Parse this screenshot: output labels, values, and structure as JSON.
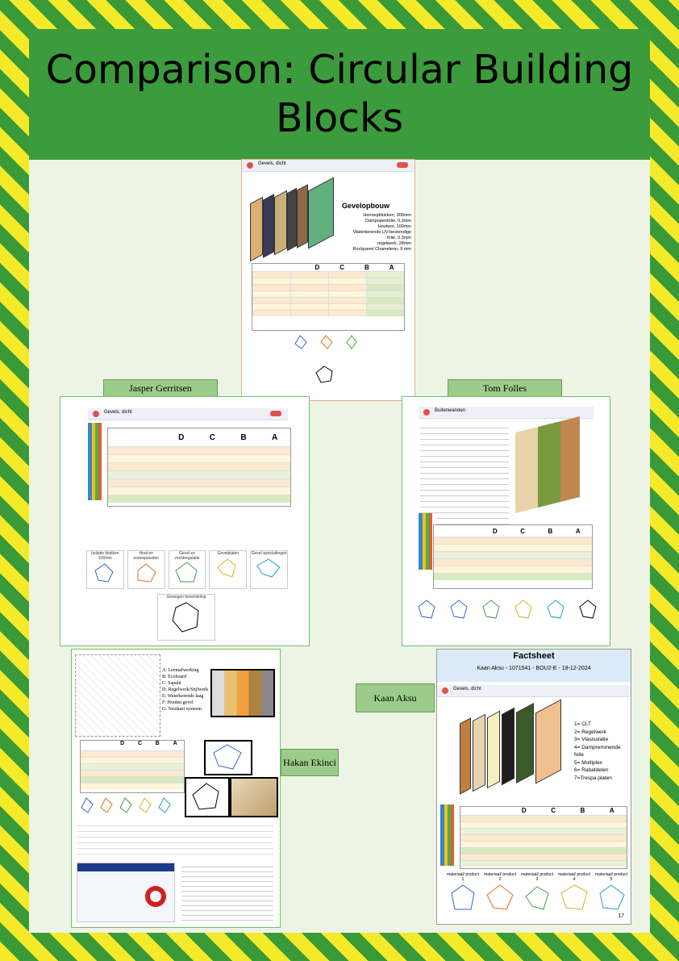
{
  "header": {
    "title": "Comparison: Circular Building Blocks"
  },
  "names": {
    "jasper": "Jasper Gerritsen",
    "tom": "Tom Folles",
    "hakan": "Hakan Ekinci",
    "kaan": "Kaan Aksu"
  },
  "top": {
    "toolbar_title": "Gevels, dicht",
    "heading": "Gevelopbouw",
    "layers": "Hennepblokken, 300mm\nDampopenfolie, 0,3mm\nHoutwol, 100mm\nWaterkerende UV-bestendige\nfolie, 0,3mm\nregelwerk, 28mm\nRockpanel Chameleon, 9 mm",
    "grades": [
      "D",
      "C",
      "B",
      "A"
    ]
  },
  "jasper": {
    "toolbar_title": "Gevels, dicht",
    "grades": [
      "D",
      "C",
      "B",
      "A"
    ],
    "radar_caps": [
      "Isolatie blokken 320mm",
      "Hout en zonnepanelen",
      "Gevel en vochtregulatie",
      "Gevelplaten",
      "Gevel aansluitingen"
    ],
    "total_cap": "Gewogen beoordeling"
  },
  "tom": {
    "toolbar_title": "Buitenwanden",
    "grades": [
      "D",
      "C",
      "B",
      "A"
    ]
  },
  "hakan": {
    "legend": [
      "A: Leemafwerking",
      "B: Ecoboard",
      "C: Sapalit",
      "D: Regelwerk/Stijlwerk",
      "E: Waterkerende laag",
      "F: Houten gevel",
      "G: Nestkast systeem"
    ],
    "grades": [
      "D",
      "C",
      "B",
      "A"
    ]
  },
  "kaan": {
    "factsheet": "Factsheet",
    "subtitle": "Kaan Aksu - 1071541 - BOU2-E - 18-12-2024",
    "toolbar_title": "Gevels, dicht",
    "layers": [
      "1= CLT",
      "2= Regelwerk",
      "3= Vlasisolatie",
      "4= Dampremmende folie",
      "5= Multiplex",
      "6= Rabatdelen",
      "7=Trespa platen"
    ],
    "grades": [
      "D",
      "C",
      "B",
      "A"
    ],
    "radar_caps": [
      "materiaal/ product 1",
      "materiaal/ product 2",
      "materiaal/ product 3",
      "materiaal/ product 4",
      "materiaal/ product 5"
    ],
    "page_number": "17"
  },
  "colors": {
    "stripe_yellow": "#f4ea2a",
    "stripe_green": "#3a9a38",
    "header_green": "#3c9b3c",
    "page_bg": "#eef4e3"
  }
}
